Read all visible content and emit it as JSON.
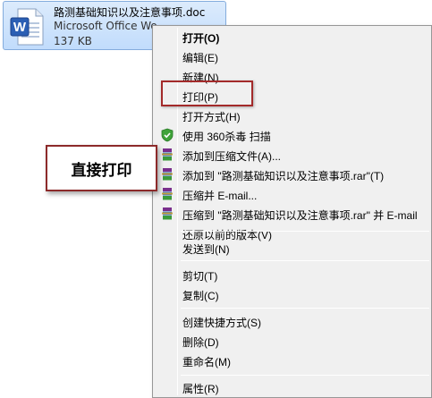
{
  "file": {
    "name": "路测基础知识以及注意事项.doc",
    "type": "Microsoft Office Word 97 - 2003",
    "size": "137 KB",
    "icon": "word-document-icon"
  },
  "menu": {
    "items": [
      {
        "label": "打开(O)",
        "bold": true
      },
      {
        "label": "编辑(E)"
      },
      {
        "label": "新建(N)"
      },
      {
        "label": "打印(P)"
      },
      {
        "label": "打开方式(H)"
      },
      {
        "label": "使用 360杀毒 扫描",
        "icon": "360-shield-icon"
      },
      {
        "label": "添加到压缩文件(A)...",
        "icon": "winrar-icon"
      },
      {
        "label": "添加到 \"路测基础知识以及注意事项.rar\"(T)",
        "icon": "winrar-icon"
      },
      {
        "label": "压缩并 E-mail...",
        "icon": "winrar-icon"
      },
      {
        "label": "压缩到 \"路测基础知识以及注意事项.rar\" 并 E-mail",
        "icon": "winrar-icon"
      },
      {
        "label": "还原以前的版本(V)"
      },
      {
        "label": "发送到(N)"
      },
      {
        "label": "剪切(T)"
      },
      {
        "label": "复制(C)"
      },
      {
        "label": "创建快捷方式(S)"
      },
      {
        "label": "删除(D)"
      },
      {
        "label": "重命名(M)"
      },
      {
        "label": "属性(R)"
      }
    ]
  },
  "annotation": {
    "callout_text": "直接打印",
    "color": "#a32a2a"
  }
}
